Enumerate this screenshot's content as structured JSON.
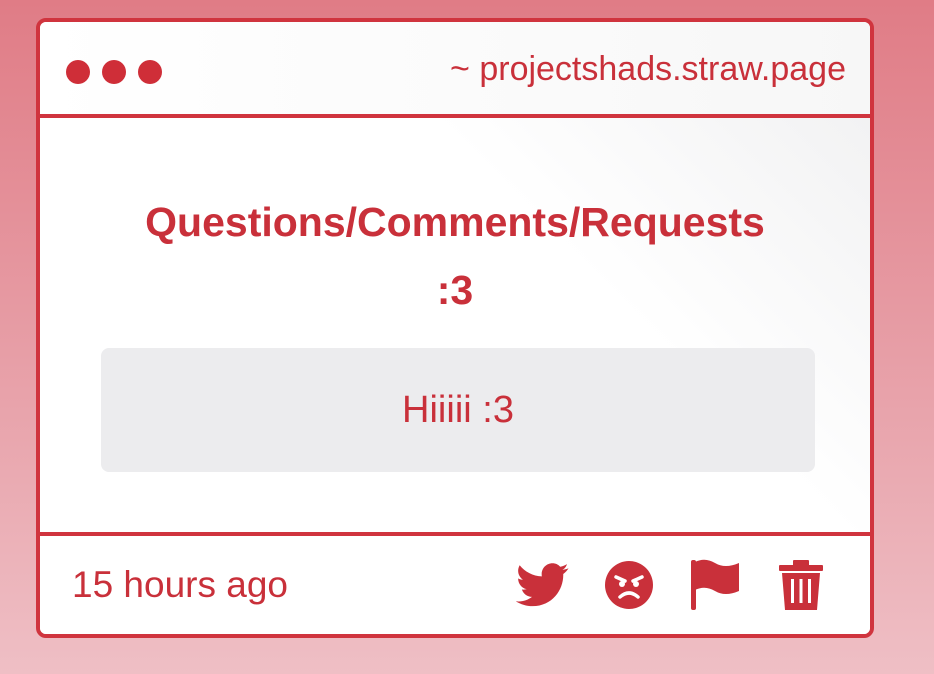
{
  "window": {
    "url": "~ projectshads.straw.page"
  },
  "content": {
    "heading_line1": "Questions/Comments/Requests",
    "heading_line2": ":3",
    "message": "Hiiiii :3"
  },
  "footer": {
    "timestamp": "15 hours ago",
    "actions": [
      {
        "icon": "twitter-icon"
      },
      {
        "icon": "angry-face-icon"
      },
      {
        "icon": "flag-icon"
      },
      {
        "icon": "trash-icon"
      }
    ]
  },
  "colors": {
    "accent": "#c9303a",
    "border": "#d0343e",
    "background_top": "#e07c86",
    "background_bottom": "#efbfc5",
    "message_box": "#ececee"
  }
}
